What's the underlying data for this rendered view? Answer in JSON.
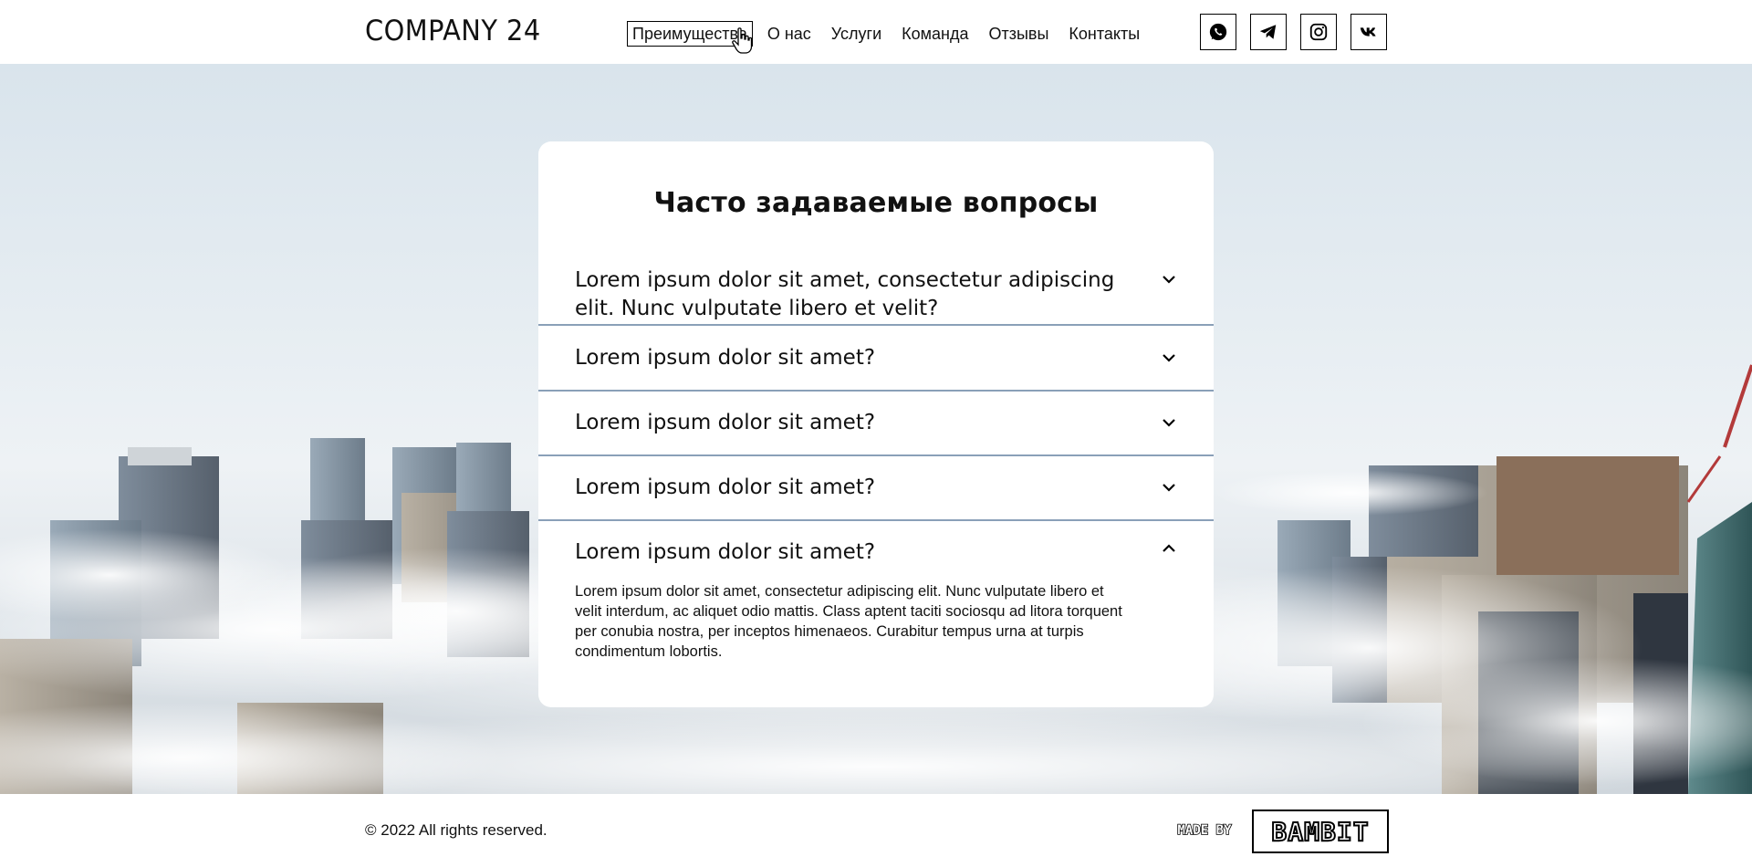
{
  "header": {
    "logo": "COMPANY 24",
    "nav": [
      "Преимущества",
      "О нас",
      "Услуги",
      "Команда",
      "Отзывы",
      "Контакты"
    ],
    "active_nav": "Преимущества",
    "socials": [
      "whatsapp-icon",
      "telegram-icon",
      "instagram-icon",
      "vk-icon"
    ]
  },
  "faq": {
    "title": "Часто задаваемые вопросы",
    "items": [
      {
        "question": "Lorem ipsum dolor sit amet, consectetur adipiscing elit. Nunc vulputate libero et velit?",
        "expanded": false
      },
      {
        "question": "Lorem ipsum dolor sit amet?",
        "expanded": false
      },
      {
        "question": "Lorem ipsum dolor sit amet?",
        "expanded": false
      },
      {
        "question": "Lorem ipsum dolor sit amet?",
        "expanded": false
      },
      {
        "question": "Lorem ipsum dolor sit amet?",
        "expanded": true,
        "answer": "Lorem ipsum dolor sit amet, consectetur adipiscing elit. Nunc vulputate libero et velit interdum, ac aliquet odio mattis. Class aptent taciti sociosqu ad litora torquent per conubia nostra, per inceptos himenaeos. Curabitur tempus urna at turpis condimentum lobortis."
      }
    ]
  },
  "footer": {
    "copyright": "© 2022 All rights reserved.",
    "made_by": "MADE BY",
    "brand": "BAMBIT"
  },
  "colors": {
    "divider": "#8aa0b8",
    "sky": "#dfe7ee"
  }
}
